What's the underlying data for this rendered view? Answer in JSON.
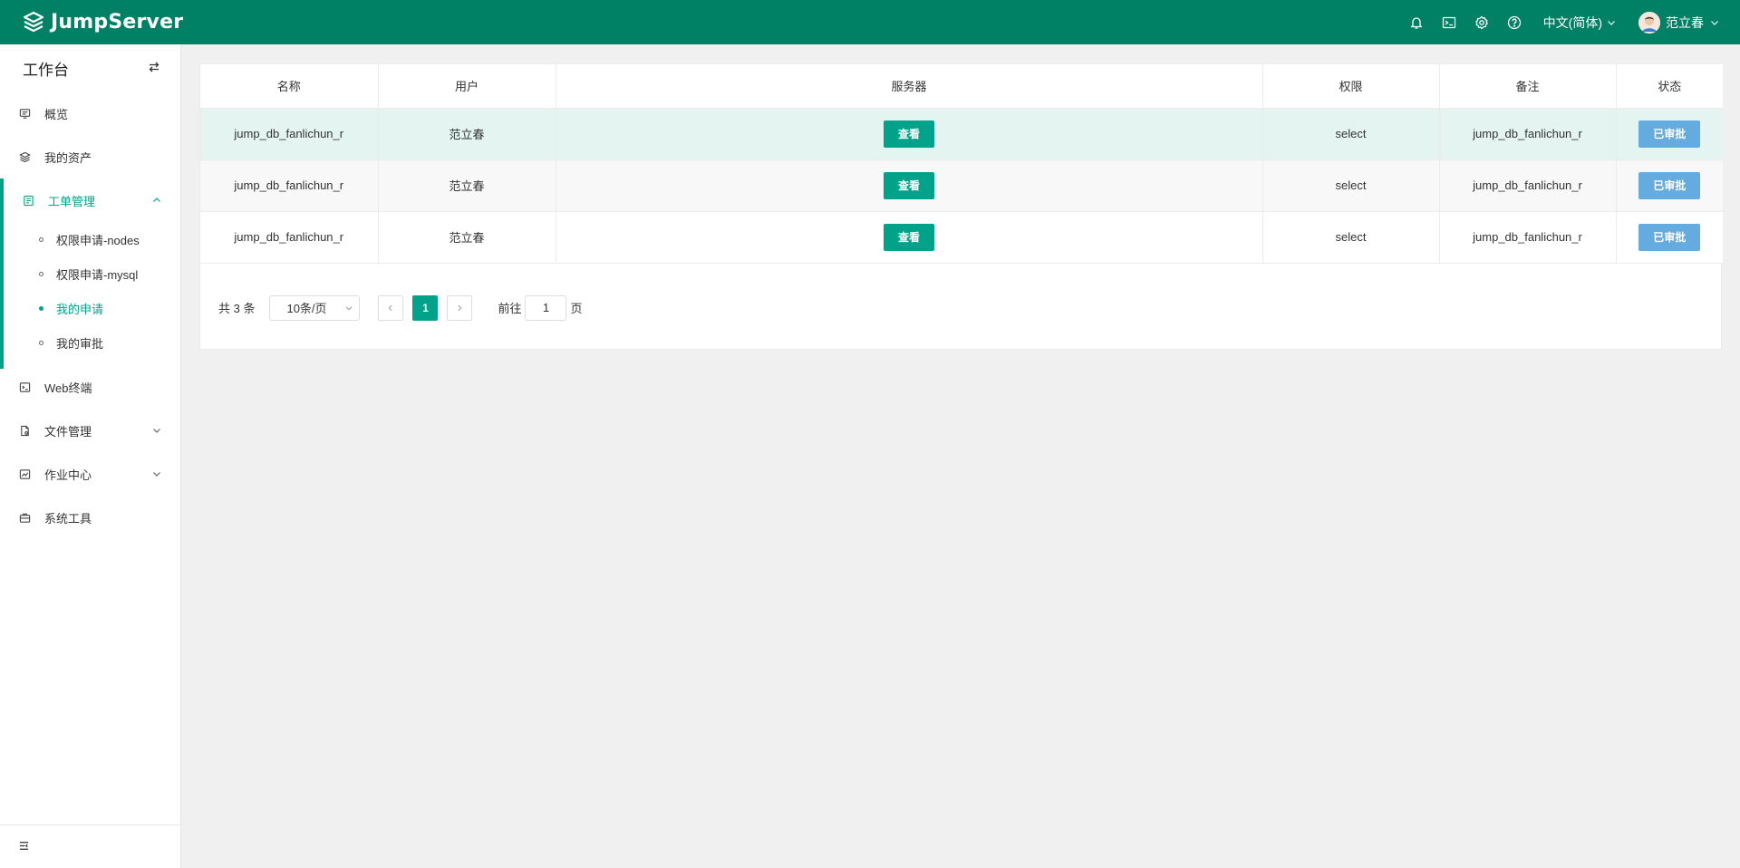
{
  "header": {
    "brand": "JumpServer",
    "language": "中文(简体)",
    "username": "范立春",
    "icons": [
      "bell-icon",
      "terminal-icon",
      "gear-icon",
      "help-icon"
    ]
  },
  "sidebar": {
    "title": "工作台",
    "items": [
      {
        "label": "概览",
        "icon": "overview-icon"
      },
      {
        "label": "我的资产",
        "icon": "layers-icon"
      },
      {
        "label": "工单管理",
        "icon": "ticket-icon",
        "expanded": true
      },
      {
        "label": "Web终端",
        "icon": "terminal-icon"
      },
      {
        "label": "文件管理",
        "icon": "file-icon"
      },
      {
        "label": "作业中心",
        "icon": "job-icon"
      },
      {
        "label": "系统工具",
        "icon": "toolbox-icon"
      }
    ],
    "ticket_sub": [
      "权限申请-nodes",
      "权限申请-mysql",
      "我的申请",
      "我的审批"
    ],
    "active_sub": "我的申请"
  },
  "table": {
    "columns": [
      "名称",
      "用户",
      "服务器",
      "权限",
      "备注",
      "状态"
    ],
    "rows": [
      {
        "name": "jump_db_fanlichun_r",
        "user": "范立春",
        "server": "查看",
        "perm": "select",
        "note": "jump_db_fanlichun_r",
        "status": "已审批"
      },
      {
        "name": "jump_db_fanlichun_r",
        "user": "范立春",
        "server": "查看",
        "perm": "select",
        "note": "jump_db_fanlichun_r",
        "status": "已审批"
      },
      {
        "name": "jump_db_fanlichun_r",
        "user": "范立春",
        "server": "查看",
        "perm": "select",
        "note": "jump_db_fanlichun_r",
        "status": "已审批"
      }
    ]
  },
  "pagination": {
    "total": "共 3 条",
    "page_size": "10条/页",
    "current": "1",
    "goto_label": "前往",
    "goto_value": "1",
    "page_suffix": "页"
  },
  "colors": {
    "brand": "#008065",
    "accent": "#00a38a",
    "status": "#64ace0"
  }
}
